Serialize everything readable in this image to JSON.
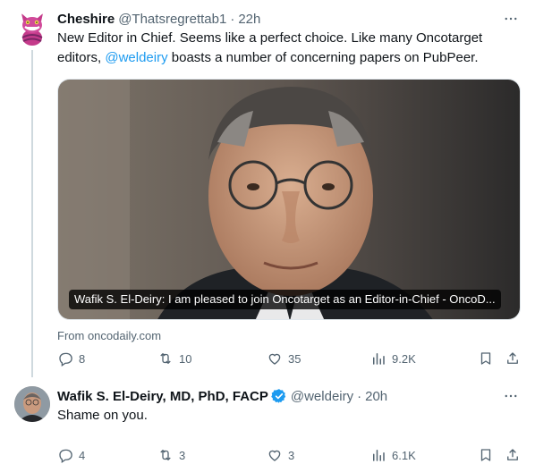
{
  "tweets": [
    {
      "name": "Cheshire",
      "handle": "@Thatsregrettab1",
      "separator": "·",
      "time": "22h",
      "text_before": "New Editor in Chief. Seems like a perfect choice. Like many Oncotarget editors, ",
      "mention": "@weldeiry",
      "text_after": " boasts a number of concerning papers on PubPeer.",
      "card": {
        "title": "Wafik S. El-Deiry: I am pleased to join Oncotarget as an Editor-in-Chief - OncoD...",
        "source": "From oncodaily.com"
      },
      "stats": {
        "replies": "8",
        "reposts": "10",
        "likes": "35",
        "views": "9.2K"
      }
    },
    {
      "name": "Wafik S. El-Deiry, MD, PhD, FACP",
      "handle": "@weldeiry",
      "separator": "·",
      "time": "20h",
      "text": "Shame on you.",
      "stats": {
        "replies": "4",
        "reposts": "3",
        "likes": "3",
        "views": "6.1K"
      }
    }
  ],
  "colors": {
    "link": "#1d9bf0",
    "secondary": "#536471",
    "verified": "#1d9bf0"
  },
  "icons": [
    "more-icon",
    "reply-icon",
    "repost-icon",
    "like-icon",
    "views-icon",
    "bookmark-icon",
    "share-icon",
    "verified-badge-icon"
  ]
}
